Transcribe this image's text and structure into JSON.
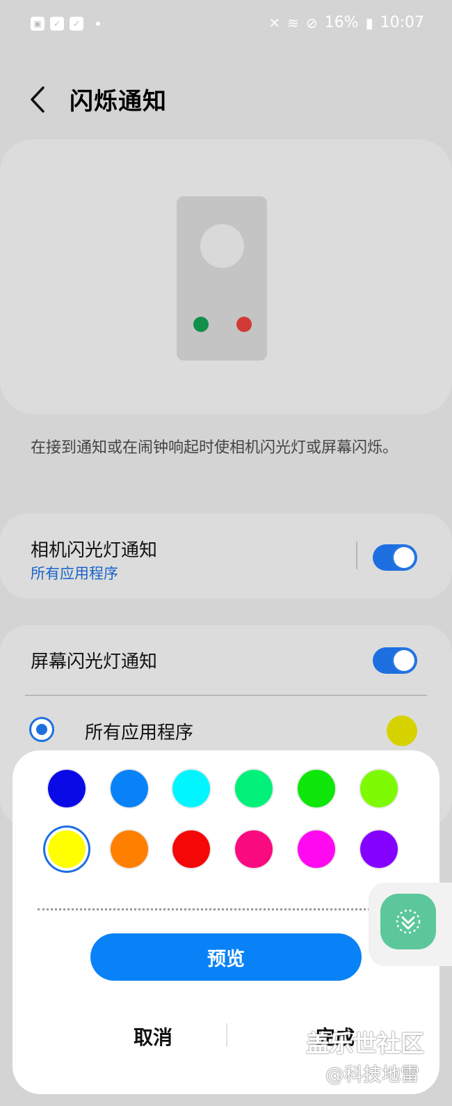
{
  "status_bar": {
    "battery": "16%",
    "time": "10:07",
    "icons_left": [
      "gallery-icon",
      "check-app-icon",
      "check-app-icon-2",
      "notification-dot"
    ],
    "icons_right": [
      "vibrate-mute-icon",
      "wifi-calling-icon",
      "do-not-disturb-icon",
      "battery-icon"
    ]
  },
  "header": {
    "title": "闪烁通知"
  },
  "preview": {
    "led_colors": [
      "#138f4c",
      "#d23a37"
    ]
  },
  "description": "在接到通知或在闹钟响起时使相机闪光灯或屏幕闪烁。",
  "camera_flash": {
    "title": "相机闪光灯通知",
    "subtitle": "所有应用程序",
    "enabled": true
  },
  "screen_flash": {
    "title": "屏幕闪光灯通知",
    "enabled": true,
    "option_label": "所有应用程序",
    "option_selected": true,
    "option_color": "#d6d200"
  },
  "color_picker": {
    "swatches": [
      "#0a0ae6",
      "#0a82f7",
      "#00f5ff",
      "#00f07a",
      "#0fe60a",
      "#7ffa05",
      "#ffff00",
      "#ff7f00",
      "#f50707",
      "#fa0a7f",
      "#ff0af0",
      "#8400ff"
    ],
    "selected_index": 6,
    "preview_label": "预览",
    "cancel_label": "取消",
    "done_label": "完成"
  },
  "accent": "#1d6fe0",
  "watermark": {
    "line1": "盖乐世社区",
    "line2": "@科技地雷"
  }
}
